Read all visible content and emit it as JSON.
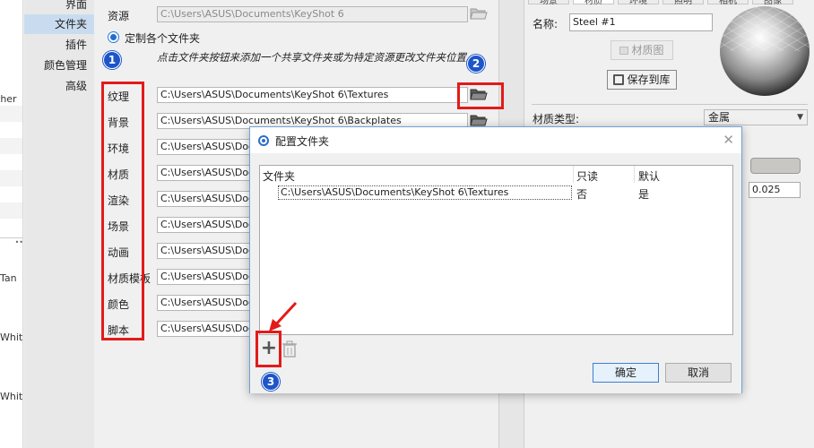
{
  "left_strip": {
    "items": [
      "ther",
      "Tan",
      "White",
      "White"
    ]
  },
  "nav": {
    "items": [
      {
        "label": "界面",
        "active": false
      },
      {
        "label": "文件夹",
        "active": true
      },
      {
        "label": "插件",
        "active": false
      },
      {
        "label": "颜色管理",
        "active": false
      },
      {
        "label": "高级",
        "active": false
      }
    ]
  },
  "settings": {
    "resource_label": "资源",
    "resource_path": "C:\\Users\\ASUS\\Documents\\KeyShot 6",
    "custom_radio_label": "定制各个文件夹",
    "hint_text": "点击文件夹按钮来添加一个共享文件夹或为特定资源更改文件夹位置。",
    "folders": [
      {
        "label": "纹理",
        "path": "C:\\Users\\ASUS\\Documents\\KeyShot 6\\Textures"
      },
      {
        "label": "背景",
        "path": "C:\\Users\\ASUS\\Documents\\KeyShot 6\\Backplates"
      },
      {
        "label": "环境",
        "path": "C:\\Users\\ASUS\\Docu"
      },
      {
        "label": "材质",
        "path": "C:\\Users\\ASUS\\Docu"
      },
      {
        "label": "渲染",
        "path": "C:\\Users\\ASUS\\Docu"
      },
      {
        "label": "场景",
        "path": "C:\\Users\\ASUS\\Docu"
      },
      {
        "label": "动画",
        "path": "C:\\Users\\ASUS\\Docu"
      },
      {
        "label": "材质模板",
        "path": "C:\\Users\\ASUS\\Docu"
      },
      {
        "label": "颜色",
        "path": "C:\\Users\\ASUS\\Docu"
      },
      {
        "label": "脚本",
        "path": "C:\\Users\\ASUS\\Docu"
      }
    ]
  },
  "right_pane": {
    "tabs": [
      "场景",
      "材质",
      "环境",
      "照明",
      "相机",
      "图像"
    ],
    "name_label": "名称:",
    "name_value": "Steel #1",
    "material_map_label": "材质图",
    "save_to_library_label": "保存到库",
    "material_type_label": "材质类型:",
    "material_type_value": "金属",
    "value_field": "0.025",
    "swatch_color": "#c9c7c4"
  },
  "dialog": {
    "title": "配置文件夹",
    "columns": [
      "文件夹",
      "只读",
      "默认"
    ],
    "rows": [
      {
        "folder": "C:\\Users\\ASUS\\Documents\\KeyShot 6\\Textures",
        "readonly": "否",
        "default": "是"
      }
    ],
    "ok_label": "确定",
    "cancel_label": "取消"
  },
  "annotations": {
    "badges": [
      "1",
      "2",
      "3"
    ],
    "accent_color": "#e31a1a",
    "badge_color": "#1d55c9"
  }
}
